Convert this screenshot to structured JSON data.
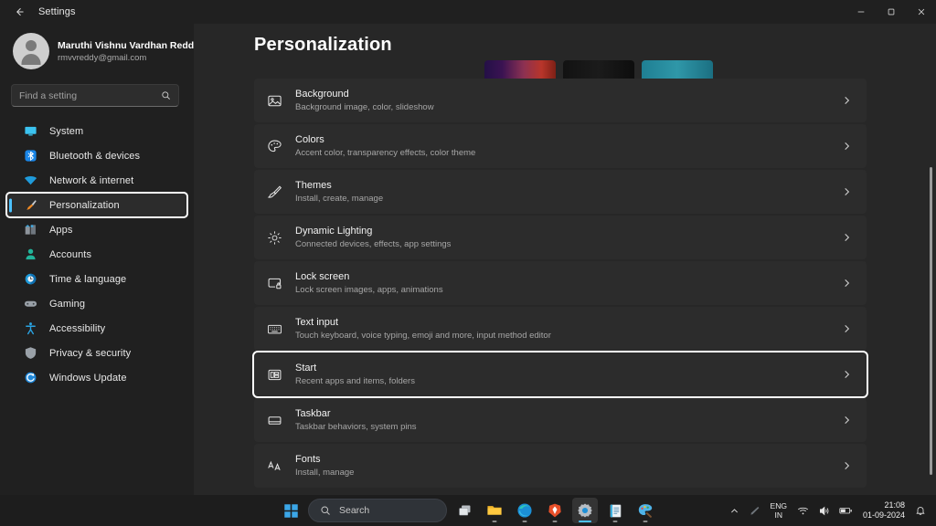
{
  "window": {
    "title": "Settings",
    "back_icon": "arrow-left-icon",
    "controls": [
      {
        "name": "minimize",
        "icon": "minimize-icon"
      },
      {
        "name": "maximize",
        "icon": "restore-icon"
      },
      {
        "name": "close",
        "icon": "close-icon"
      }
    ]
  },
  "account": {
    "name": "Maruthi Vishnu Vardhan Redd...",
    "email": "rmvvreddy@gmail.com",
    "avatar_icon": "user-avatar-icon"
  },
  "search": {
    "placeholder": "Find a setting",
    "value": "",
    "icon": "search-icon"
  },
  "sidebar": {
    "items": [
      {
        "label": "System",
        "icon": "monitor-icon",
        "selected": false
      },
      {
        "label": "Bluetooth & devices",
        "icon": "bluetooth-icon",
        "selected": false
      },
      {
        "label": "Network & internet",
        "icon": "wifi-icon",
        "selected": false
      },
      {
        "label": "Personalization",
        "icon": "paintbrush-icon",
        "selected": true
      },
      {
        "label": "Apps",
        "icon": "apps-icon",
        "selected": false
      },
      {
        "label": "Accounts",
        "icon": "person-icon",
        "selected": false
      },
      {
        "label": "Time & language",
        "icon": "clock-icon",
        "selected": false
      },
      {
        "label": "Gaming",
        "icon": "gamepad-icon",
        "selected": false
      },
      {
        "label": "Accessibility",
        "icon": "accessibility-icon",
        "selected": false
      },
      {
        "label": "Privacy & security",
        "icon": "shield-icon",
        "selected": false
      },
      {
        "label": "Windows Update",
        "icon": "update-icon",
        "selected": false
      }
    ]
  },
  "main": {
    "title": "Personalization",
    "theme_thumbnails": [
      {
        "name": "theme-thumbnail-1",
        "gradient": "linear-gradient(90deg,#241047 0%,#3a1352 25%,#8c3152 55%,#b8352a 80%,#7d2016 100%)"
      },
      {
        "name": "theme-thumbnail-2",
        "gradient": "linear-gradient(90deg,#121212 0%,#1b1b1b 50%,#0d0d0d 100%)"
      },
      {
        "name": "theme-thumbnail-3",
        "gradient": "linear-gradient(90deg,#1f7f93 0%,#2f97a8 50%,#1b6f82 100%)"
      }
    ],
    "rows": [
      {
        "title": "Background",
        "subtitle": "Background image, color, slideshow",
        "icon": "image-icon",
        "focused": false
      },
      {
        "title": "Colors",
        "subtitle": "Accent color, transparency effects, color theme",
        "icon": "palette-icon",
        "focused": false
      },
      {
        "title": "Themes",
        "subtitle": "Install, create, manage",
        "icon": "paintbrush-icon",
        "focused": false
      },
      {
        "title": "Dynamic Lighting",
        "subtitle": "Connected devices, effects, app settings",
        "icon": "sparkle-icon",
        "focused": false
      },
      {
        "title": "Lock screen",
        "subtitle": "Lock screen images, apps, animations",
        "icon": "lock-screen-icon",
        "focused": false
      },
      {
        "title": "Text input",
        "subtitle": "Touch keyboard, voice typing, emoji and more, input method editor",
        "icon": "keyboard-icon",
        "focused": false
      },
      {
        "title": "Start",
        "subtitle": "Recent apps and items, folders",
        "icon": "start-icon",
        "focused": true
      },
      {
        "title": "Taskbar",
        "subtitle": "Taskbar behaviors, system pins",
        "icon": "taskbar-icon",
        "focused": false
      },
      {
        "title": "Fonts",
        "subtitle": "Install, manage",
        "icon": "fonts-icon",
        "focused": false
      }
    ],
    "chevron_icon": "chevron-right-icon"
  },
  "taskbar": {
    "start_icon": "windows-start-icon",
    "search": {
      "label": "Search",
      "icon": "search-icon"
    },
    "apps": [
      {
        "name": "task-view",
        "icon": "task-view-icon"
      },
      {
        "name": "file-explorer",
        "icon": "folder-icon"
      },
      {
        "name": "microsoft-edge",
        "icon": "edge-icon"
      },
      {
        "name": "brave-browser",
        "icon": "brave-icon"
      },
      {
        "name": "settings",
        "icon": "gear-icon"
      },
      {
        "name": "notepad",
        "icon": "notepad-icon"
      },
      {
        "name": "paint",
        "icon": "paint-icon"
      }
    ],
    "tray": {
      "show_hidden_icon": "chevron-up-icon",
      "pen_icon": "pen-icon",
      "language": {
        "line1": "ENG",
        "line2": "IN"
      },
      "network_icon": "wifi-icon",
      "volume_icon": "speaker-icon",
      "battery_icon": "battery-icon",
      "time": "21:08",
      "date": "01-09-2024",
      "notification_icon": "bell-icon"
    }
  },
  "colors": {
    "accent": "#4cc2ff",
    "window_bg": "#202020",
    "content_bg": "#272727",
    "row_bg": "#2c2c2c",
    "taskbar_bg": "#1d1d1d"
  }
}
